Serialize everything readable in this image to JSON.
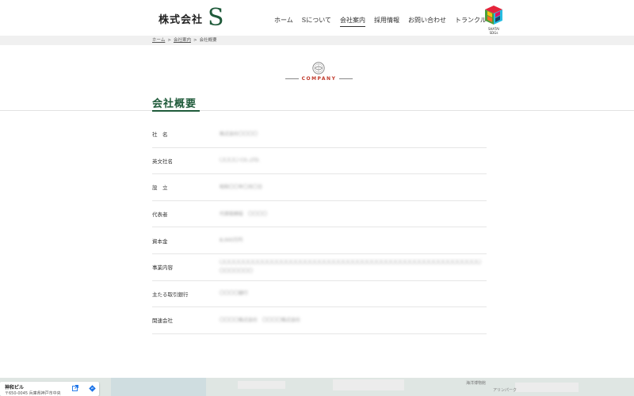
{
  "header": {
    "logo_name": "株式会社",
    "logo_mark": "S",
    "nav": [
      {
        "label": "ホーム"
      },
      {
        "label": "Sについて"
      },
      {
        "label": "会社案内",
        "active": true
      },
      {
        "label": "採用情報"
      },
      {
        "label": "お問い合わせ"
      },
      {
        "label": "トランクルーム"
      }
    ],
    "sdgs_label": "SHATAI SDGs"
  },
  "breadcrumb": {
    "home": "ホーム",
    "parent": "会社案内",
    "current": "会社概要",
    "separator": ">"
  },
  "section": {
    "label": "COMPANY",
    "title": "会社概要"
  },
  "company_table": [
    {
      "label": "社　名",
      "value": "株式会社〇〇〇〇"
    },
    {
      "label": "英文社名",
      "value": "〇〇〇〇 CO.,LTD."
    },
    {
      "label": "設　立",
      "value": "昭和〇〇年〇月〇日"
    },
    {
      "label": "代表者",
      "value": "代表取締役　〇〇〇〇"
    },
    {
      "label": "資本金",
      "value": "8,000万円"
    },
    {
      "label": "事業内容",
      "value": "〇〇〇〇〇〇〇〇〇〇〇〇〇〇〇〇〇〇〇〇〇〇〇〇〇〇〇〇〇〇〇〇〇〇〇〇〇〇〇〇〇〇〇〇〇〇〇〇〇〇〇〇〇〇〇〇〇〇〇〇〇〇"
    },
    {
      "label": "主たる取引銀行",
      "value": "〇〇〇〇銀行"
    },
    {
      "label": "関連会社",
      "value": "〇〇〇〇株式会社　〇〇〇〇株式会社"
    }
  ],
  "map": {
    "place_name": "神和ビル",
    "address": "〒650-0045 兵庫県神戸市中央",
    "labels": [
      "海洋博物館",
      "アリンパーク"
    ]
  },
  "colors": {
    "brand_green": "#1f5a3a",
    "accent_red": "#c0392b"
  }
}
